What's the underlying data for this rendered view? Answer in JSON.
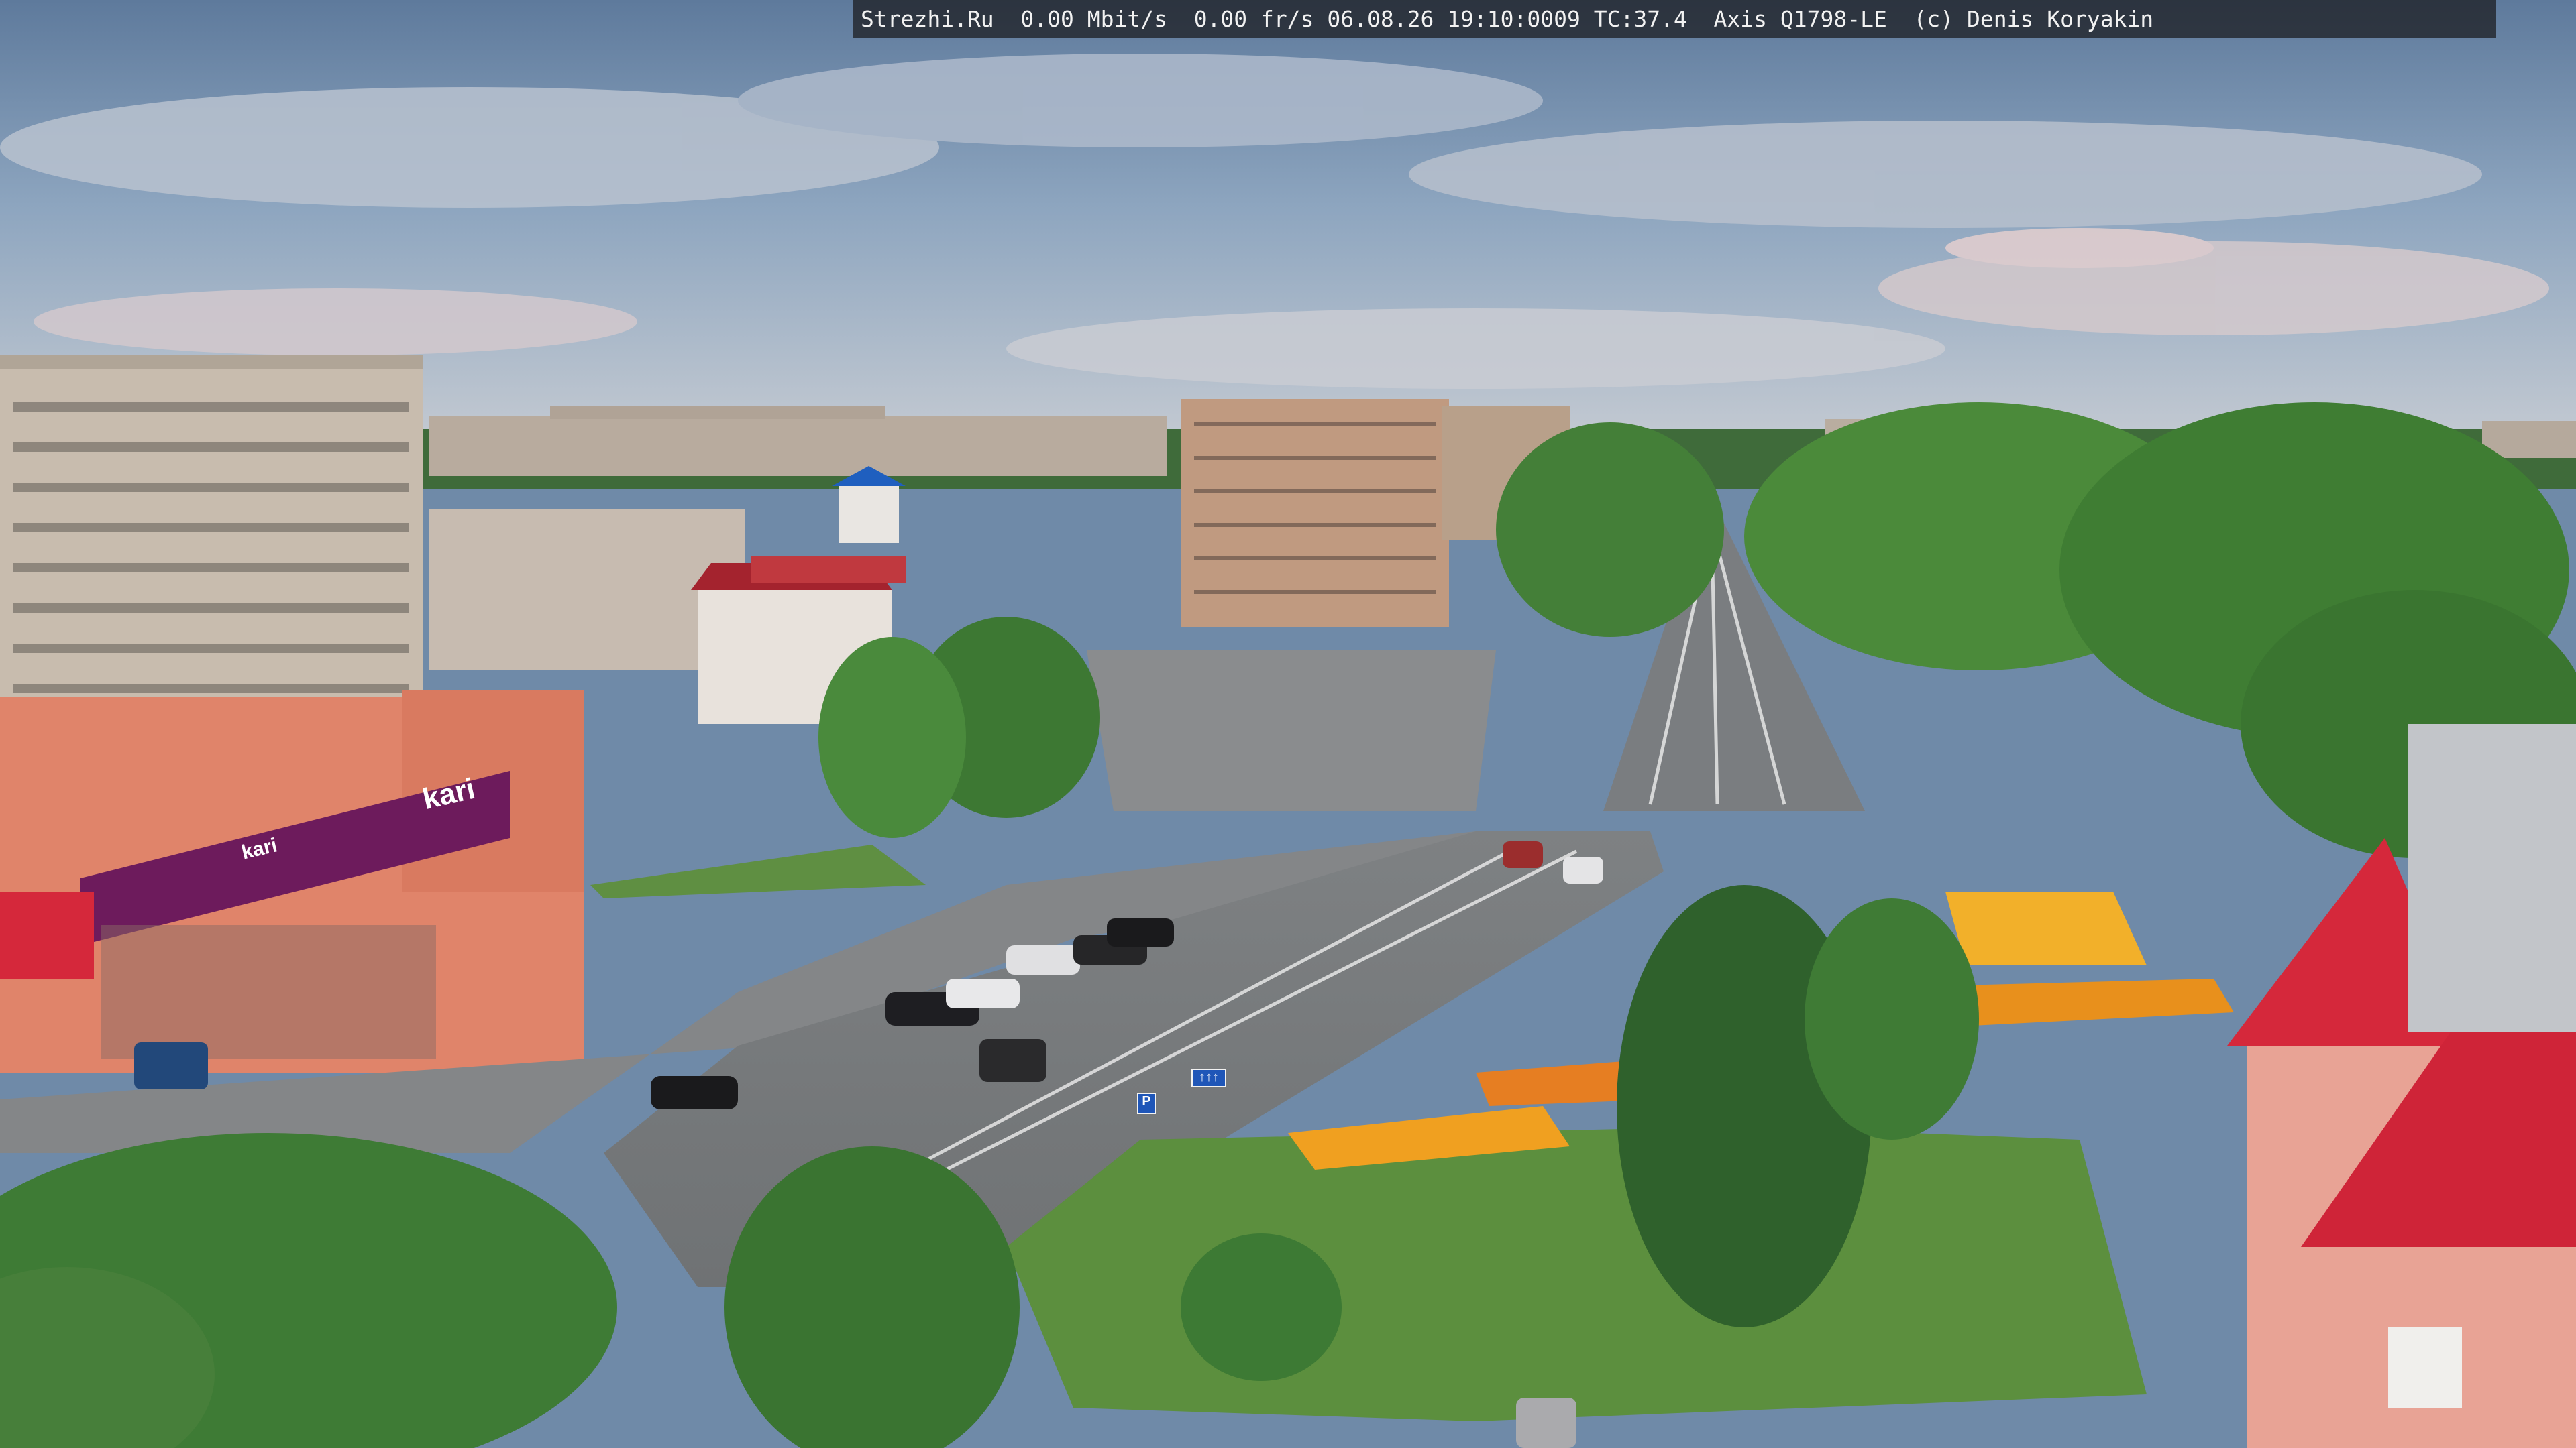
{
  "camera_overlay": {
    "text": "Strezhi.Ru  0.00 Mbit/s  0.00 fr/s 06.08.26 19:10:0009 TC:37.4  Axis Q1798-LE  (c) Denis Koryakin"
  },
  "storefront": {
    "brand": "kari",
    "brand_small": "kari"
  },
  "road_signs": {
    "lane_sign": "↑↑↑",
    "parking_sign": "P"
  },
  "colors": {
    "sky": "#6f8aa8",
    "cloud": "#c9cdd6",
    "asphalt": "#7a7d80",
    "grass": "#5c8f3e",
    "trees": "#3f7a34",
    "shop_purple": "#6d1b5c",
    "roof_red": "#d5283b",
    "flowers": "#f0a020"
  }
}
